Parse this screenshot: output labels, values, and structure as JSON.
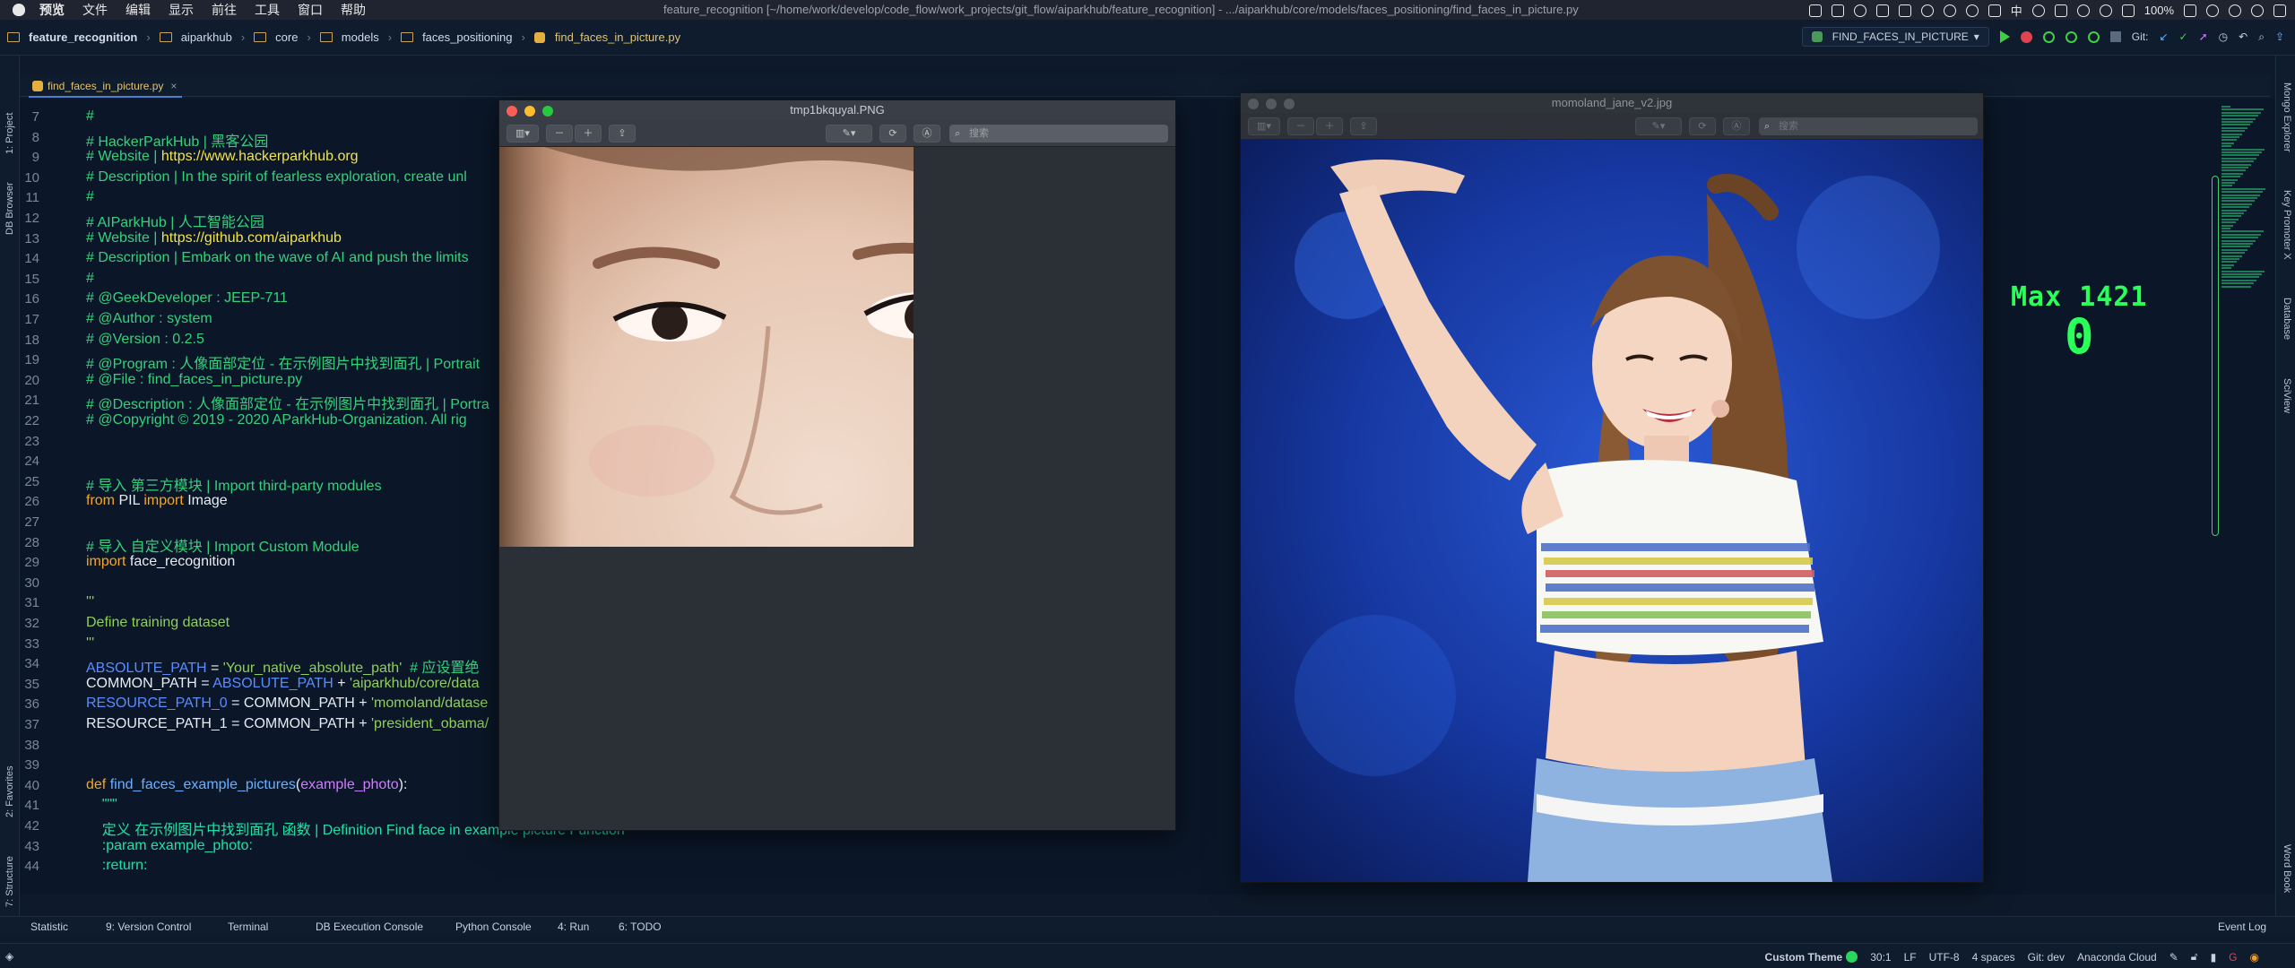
{
  "menubar": {
    "app": "预览",
    "items": [
      "文件",
      "编辑",
      "显示",
      "前往",
      "工具",
      "窗口",
      "帮助"
    ],
    "window_title": "feature_recognition [~/home/work/develop/code_flow/work_projects/git_flow/aiparkhub/feature_recognition] - .../aiparkhub/core/models/faces_positioning/find_faces_in_picture.py",
    "battery": "100%",
    "input_method": "中"
  },
  "navbar": {
    "crumbs": [
      "feature_recognition",
      "aiparkhub",
      "core",
      "models",
      "faces_positioning",
      "find_faces_in_picture.py"
    ],
    "run_config": "FIND_FACES_IN_PICTURE",
    "git_label": "Git:"
  },
  "tab": {
    "label": "find_faces_in_picture.py"
  },
  "left_strip": [
    "1: Project",
    "DB Browser",
    "2: Favorites",
    "7: Structure"
  ],
  "right_strip": [
    "Mongo Explorer",
    "Key Promoter X",
    "Database",
    "SciView",
    "Word Book"
  ],
  "code": {
    "lines": [
      {
        "n": "7",
        "segs": [
          [
            "#",
            "c-com"
          ]
        ]
      },
      {
        "n": "8",
        "segs": [
          [
            "# HackerParkHub | 黑客公园",
            "c-com"
          ]
        ]
      },
      {
        "n": "9",
        "segs": [
          [
            "# Website | ",
            "c-com"
          ],
          [
            "https://www.hackerparkhub.org",
            "c-url"
          ]
        ]
      },
      {
        "n": "10",
        "segs": [
          [
            "# Description | In the spirit of fearless exploration, create unl",
            "c-com"
          ]
        ]
      },
      {
        "n": "11",
        "segs": [
          [
            "#",
            "c-com"
          ]
        ]
      },
      {
        "n": "12",
        "segs": [
          [
            "# AIParkHub | 人工智能公园",
            "c-com"
          ]
        ]
      },
      {
        "n": "13",
        "segs": [
          [
            "# Website | ",
            "c-com"
          ],
          [
            "https://github.com/aiparkhub",
            "c-url"
          ]
        ]
      },
      {
        "n": "14",
        "segs": [
          [
            "# Description | Embark on the wave of AI and push the limits",
            "c-com"
          ]
        ]
      },
      {
        "n": "15",
        "segs": [
          [
            "#",
            "c-com"
          ]
        ]
      },
      {
        "n": "16",
        "segs": [
          [
            "# @GeekDeveloper : JEEP-711",
            "c-com"
          ]
        ]
      },
      {
        "n": "17",
        "segs": [
          [
            "# @Author : system",
            "c-com"
          ]
        ]
      },
      {
        "n": "18",
        "segs": [
          [
            "# @Version : 0.2.5",
            "c-com"
          ]
        ]
      },
      {
        "n": "19",
        "segs": [
          [
            "# @Program : 人像面部定位 - 在示例图片中找到面孔 | Portrait",
            "c-com"
          ]
        ]
      },
      {
        "n": "20",
        "segs": [
          [
            "# @File : find_faces_in_picture.py",
            "c-com"
          ]
        ]
      },
      {
        "n": "21",
        "segs": [
          [
            "# @Description : 人像面部定位 - 在示例图片中找到面孔 | Portra",
            "c-com"
          ]
        ]
      },
      {
        "n": "22",
        "segs": [
          [
            "# @Copyright © 2019 - 2020 AParkHub-Organization. All rig",
            "c-com"
          ]
        ]
      },
      {
        "n": "23",
        "segs": []
      },
      {
        "n": "24",
        "segs": []
      },
      {
        "n": "25",
        "segs": [
          [
            "# 导入 第三方模块 | Import third-party modules",
            "c-com"
          ]
        ]
      },
      {
        "n": "26",
        "segs": [
          [
            "from ",
            "c-kw"
          ],
          [
            "PIL ",
            "c-wht"
          ],
          [
            "import ",
            "c-kw"
          ],
          [
            "Image",
            "c-wht"
          ]
        ]
      },
      {
        "n": "27",
        "segs": []
      },
      {
        "n": "28",
        "segs": [
          [
            "# 导入 自定义模块 | Import Custom Module",
            "c-com"
          ]
        ]
      },
      {
        "n": "29",
        "segs": [
          [
            "import ",
            "c-kw"
          ],
          [
            "face_recognition",
            "c-wht"
          ]
        ]
      },
      {
        "n": "30",
        "segs": []
      },
      {
        "n": "31",
        "segs": [
          [
            "'''",
            "c-str"
          ]
        ]
      },
      {
        "n": "32",
        "segs": [
          [
            "Define training dataset",
            "c-str"
          ]
        ]
      },
      {
        "n": "33",
        "segs": [
          [
            "'''",
            "c-str"
          ]
        ]
      },
      {
        "n": "34",
        "segs": [
          [
            "ABSOLUTE_PATH",
            "c-var"
          ],
          [
            " = ",
            "c-wht"
          ],
          [
            "'Your_native_absolute_path'",
            "c-str"
          ],
          [
            "  # 应设置绝",
            "c-com"
          ]
        ]
      },
      {
        "n": "35",
        "segs": [
          [
            "COMMON_PATH = ",
            "c-wht"
          ],
          [
            "ABSOLUTE_PATH",
            "c-var"
          ],
          [
            " + ",
            "c-wht"
          ],
          [
            "'aiparkhub/core/data",
            "c-str"
          ]
        ]
      },
      {
        "n": "36",
        "segs": [
          [
            "RESOURCE_PATH_0",
            "c-var"
          ],
          [
            " = COMMON_PATH + ",
            "c-wht"
          ],
          [
            "'momoland/datase",
            "c-str"
          ]
        ]
      },
      {
        "n": "37",
        "segs": [
          [
            "RESOURCE_PATH_1 = COMMON_PATH + ",
            "c-wht"
          ],
          [
            "'president_obama/",
            "c-str"
          ]
        ]
      },
      {
        "n": "38",
        "segs": []
      },
      {
        "n": "39",
        "segs": []
      },
      {
        "n": "40",
        "segs": [
          [
            "def ",
            "c-kw"
          ],
          [
            "find_faces_example_pictures",
            "c-fn"
          ],
          [
            "(",
            "c-wht"
          ],
          [
            "example_photo",
            "c-par"
          ],
          [
            "):",
            "c-wht"
          ]
        ]
      },
      {
        "n": "41",
        "segs": [
          [
            "    \"\"\"",
            "c-doc"
          ]
        ]
      },
      {
        "n": "42",
        "segs": [
          [
            "    定义 在示例图片中找到面孔 函数 | Definition Find face in example picture Function",
            "c-doc"
          ]
        ]
      },
      {
        "n": "43",
        "segs": [
          [
            "    :param example_photo:",
            "c-doc"
          ]
        ]
      },
      {
        "n": "44",
        "segs": [
          [
            "    :return:",
            "c-doc"
          ]
        ]
      }
    ]
  },
  "toolwindows": [
    "Statistic",
    "9: Version Control",
    "Terminal",
    "DB Execution Console",
    "Python Console",
    "4: Run",
    "6: TODO",
    "Event Log"
  ],
  "statusbar": {
    "theme": "Custom Theme",
    "pos": "30:1",
    "lf": "LF",
    "enc": "UTF-8",
    "indent": "4 spaces",
    "git": "Git: dev",
    "env": "Anaconda Cloud"
  },
  "preview_left": {
    "title": "tmp1bkquyal.PNG",
    "search_placeholder": "搜索"
  },
  "preview_right": {
    "title": "momoland_jane_v2.jpg",
    "search_placeholder": "搜索"
  },
  "overlay": {
    "title": "Max 1421",
    "value": "0"
  }
}
